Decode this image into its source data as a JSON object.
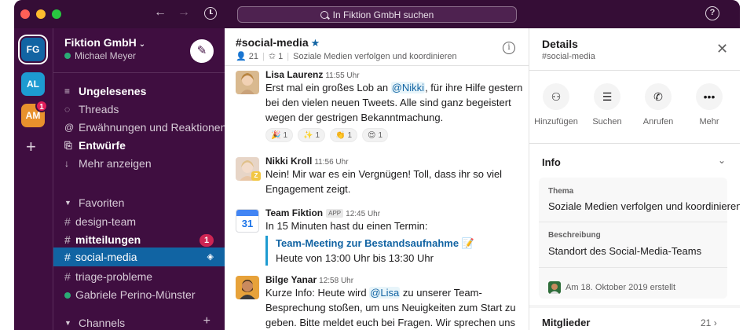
{
  "titlebar": {
    "search_placeholder": "In Fiktion GmbH suchen",
    "back_icon": "arrow-left-icon",
    "forward_icon": "arrow-right-icon",
    "history_icon": "clock-icon",
    "help_icon": "question-icon"
  },
  "workspaces": [
    {
      "initials": "FG",
      "color": "#1264a3",
      "active": true
    },
    {
      "initials": "AL",
      "color": "#1d9bd1"
    },
    {
      "initials": "AM",
      "color": "#e8912d",
      "badge": "1"
    }
  ],
  "sidebar": {
    "workspace_name": "Fiktion GmbH",
    "user_name": "Michael Meyer",
    "nav": [
      {
        "label": "Ungelesenes",
        "icon": "unread-icon",
        "bold": true
      },
      {
        "label": "Threads",
        "icon": "threads-icon"
      },
      {
        "label": "Erwähnungen und Reaktionen",
        "icon": "at-icon"
      },
      {
        "label": "Entwürfe",
        "icon": "drafts-icon",
        "bold": true
      },
      {
        "label": "Mehr anzeigen",
        "icon": "arrow-down-icon"
      }
    ],
    "favorites_label": "Favoriten",
    "favorites": [
      {
        "label": "design-team"
      },
      {
        "label": "mitteilungen",
        "bold": true,
        "badge": "1"
      },
      {
        "label": "social-media",
        "active": true
      },
      {
        "label": "triage-probleme"
      },
      {
        "label": "Gabriele Perino-Münster",
        "dm": true
      }
    ],
    "channels_label": "Channels"
  },
  "channel": {
    "name": "#social-media",
    "members": "21",
    "pins": "1",
    "topic": "Soziale Medien verfolgen und koordinieren"
  },
  "messages": [
    {
      "author": "Lisa Laurenz",
      "time": "11:55 Uhr",
      "text_pre": "Erst mal ein großes Lob an ",
      "mention": "@Nikki",
      "text_post": ", für ihre Hilfe gestern bei den vielen neuen Tweets. Alle sind ganz begeistert wegen der gestrigen Bekanntmachung.",
      "reactions": [
        {
          "emoji": "🎉",
          "count": "1"
        },
        {
          "emoji": "✨",
          "count": "1"
        },
        {
          "emoji": "👏",
          "count": "1"
        },
        {
          "emoji": "😍",
          "count": "1"
        }
      ]
    },
    {
      "author": "Nikki Kroll",
      "time": "11:56 Uhr",
      "status_badge": "Z",
      "text": "Nein! Mir war es ein Vergnügen! Toll, dass ihr so viel Engagement zeigt."
    },
    {
      "author": "Team Fiktion",
      "app_label": "APP",
      "time": "12:45 Uhr",
      "calendar_day": "31",
      "text": "In 15 Minuten hast du einen Termin:",
      "event_title": "Team-Meeting zur Bestandsaufnahme 📝",
      "event_time": "Heute von 13:00 Uhr bis 13:30 Uhr"
    },
    {
      "author": "Bilge Yanar",
      "time": "12:58 Uhr",
      "text_pre": "Kurze Info: Heute wird ",
      "mention": "@Lisa",
      "text_post": " zu unserer Team-Besprechung stoßen, um uns Neuigkeiten zum Start zu geben. Bitte meldet euch bei Fragen. Wir sprechen uns dann alle später ..."
    }
  ],
  "details": {
    "title": "Details",
    "subtitle": "#social-media",
    "actions": [
      {
        "label": "Hinzufügen",
        "icon": "add-person-icon"
      },
      {
        "label": "Suchen",
        "icon": "search-list-icon"
      },
      {
        "label": "Anrufen",
        "icon": "phone-icon"
      },
      {
        "label": "Mehr",
        "icon": "more-icon"
      }
    ],
    "info_title": "Info",
    "topic_label": "Thema",
    "topic_value": "Soziale Medien verfolgen und koordinieren",
    "description_label": "Beschreibung",
    "description_value": "Standort des Social-Media-Teams",
    "created": "Am 18. Oktober 2019 erstellt",
    "members_label": "Mitglieder",
    "members_count": "21"
  }
}
